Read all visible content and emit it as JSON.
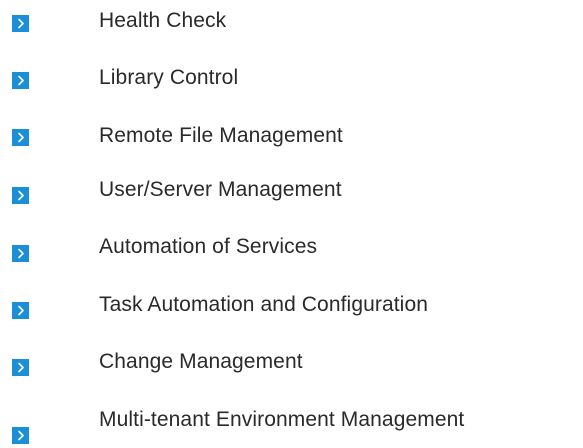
{
  "colors": {
    "accent": "#1a8fd8",
    "text": "#2a2a2a",
    "background": "#ffffff"
  },
  "features": {
    "icon": "chevron-right-icon",
    "items": [
      {
        "label": "Health Check"
      },
      {
        "label": "Library Control"
      },
      {
        "label": "Remote File Management"
      },
      {
        "label": "User/Server Management"
      },
      {
        "label": "Automation of Services"
      },
      {
        "label": "Task Automation and Configuration"
      },
      {
        "label": "Change Management"
      },
      {
        "label": "Multi-tenant Environment Management"
      }
    ]
  }
}
